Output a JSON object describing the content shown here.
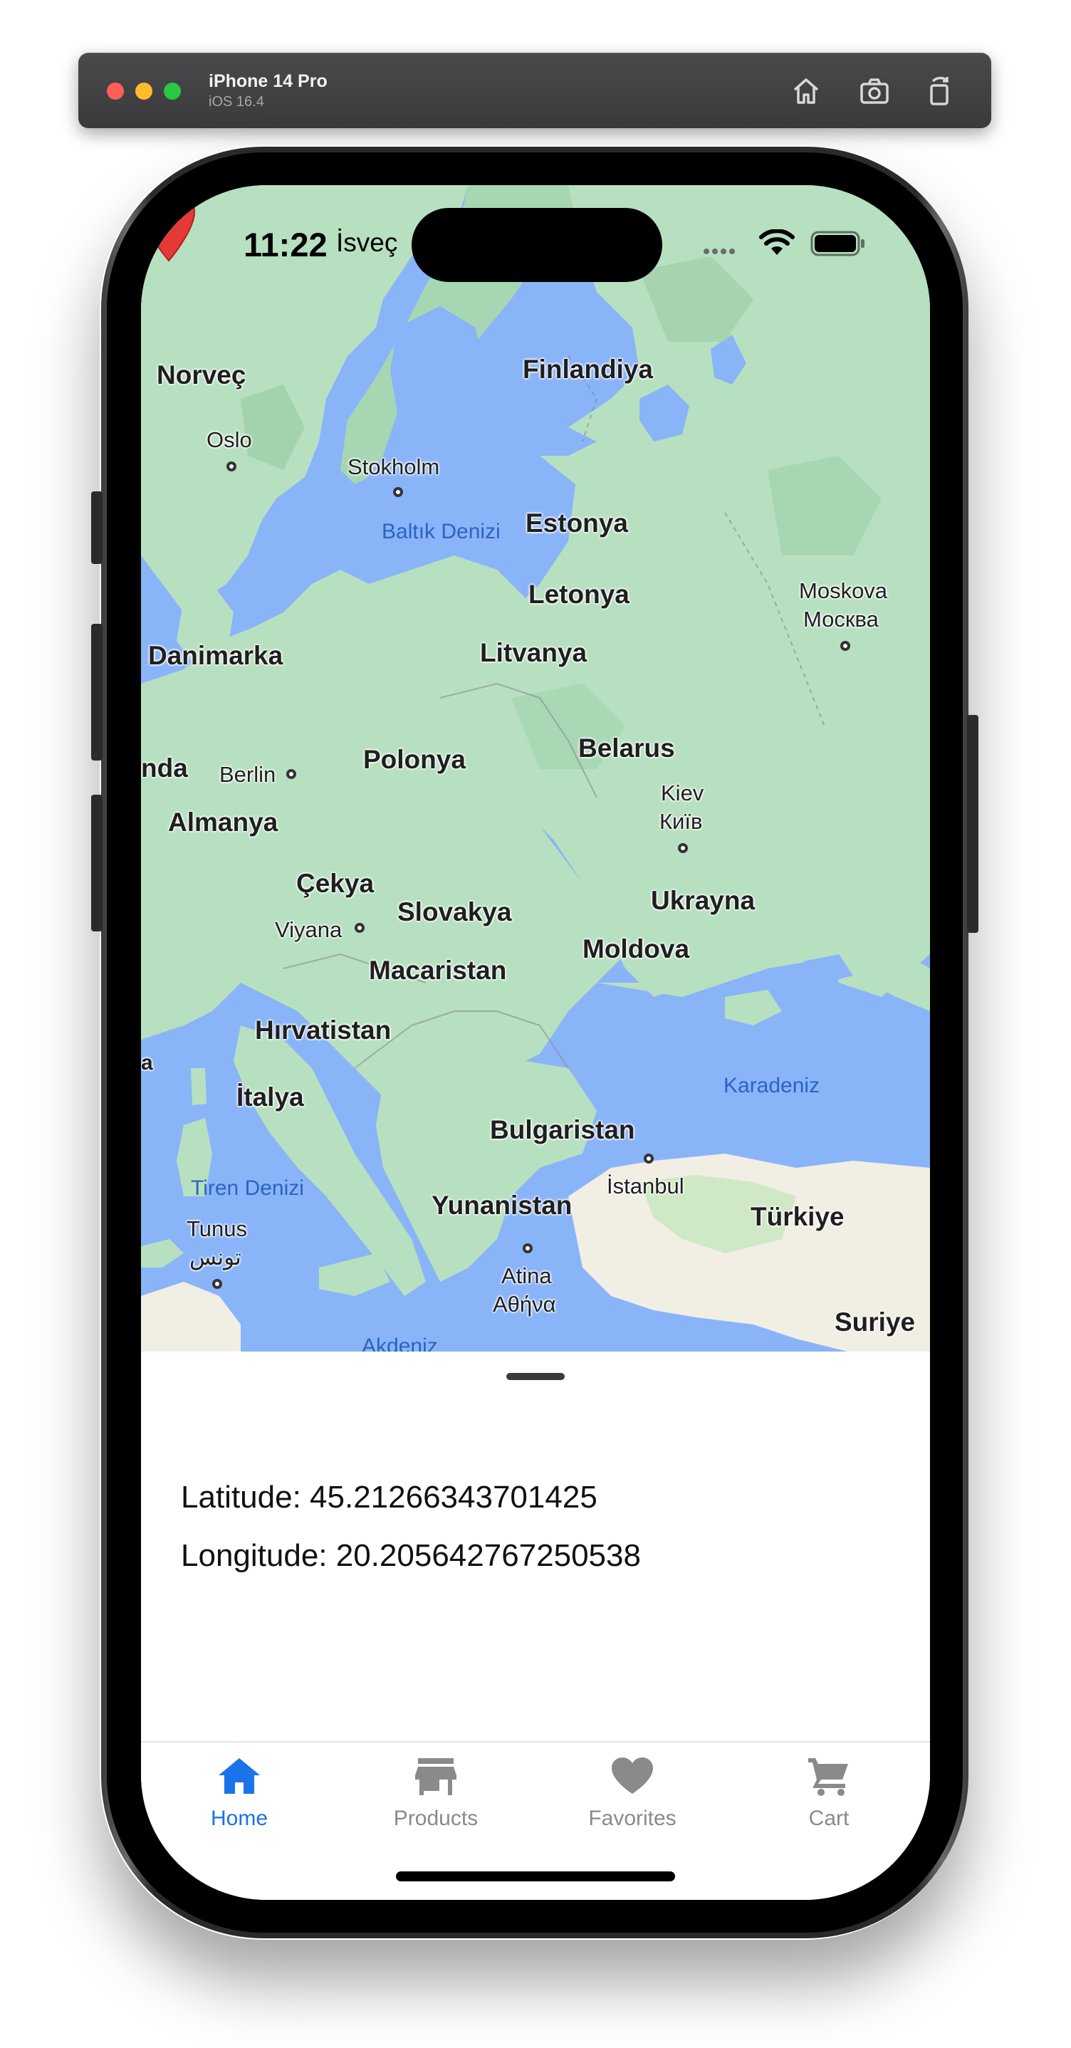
{
  "simulator": {
    "device": "iPhone 14 Pro",
    "os": "iOS 16.4",
    "icons": [
      "home-icon",
      "screenshot-icon",
      "rotate-icon"
    ]
  },
  "status_bar": {
    "time": "11:22",
    "carrier": "İsveç"
  },
  "map": {
    "countries": [
      "Norveç",
      "Finlandiya",
      "Estonya",
      "Letonya",
      "Litvanya",
      "Danimarka",
      "Polonya",
      "Belarus",
      "Almanya",
      "Çekya",
      "Slovakya",
      "Ukrayna",
      "Macaristan",
      "Moldova",
      "Hırvatistan",
      "İtalya",
      "Bulgaristan",
      "Yunanistan",
      "Türkiye",
      "Suriye",
      "nda",
      "a"
    ],
    "cities": [
      "Oslo",
      "Stokholm",
      "Moskova",
      "Москва",
      "Berlin",
      "Kiev",
      "Київ",
      "Viyana",
      "İstanbul",
      "Tunus",
      "تونس",
      "Atina",
      "Αθήνα"
    ],
    "waters": [
      "Baltık Denizi",
      "Karadeniz",
      "Tiren Denizi",
      "Akdeniz"
    ],
    "pin_color": "#e53935"
  },
  "location": {
    "latitude_text": "Latitude: 45.21266343701425",
    "longitude_text": "Longitude: 20.205642767250538"
  },
  "tabs": [
    {
      "label": "Home",
      "icon": "home-icon",
      "active": true
    },
    {
      "label": "Products",
      "icon": "store-icon",
      "active": false
    },
    {
      "label": "Favorites",
      "icon": "heart-icon",
      "active": false
    },
    {
      "label": "Cart",
      "icon": "cart-icon",
      "active": false
    }
  ],
  "colors": {
    "accent": "#1a73e8",
    "inactive": "#8a8a8a",
    "water": "#8ab4f8",
    "land": "#b7e0c0"
  }
}
